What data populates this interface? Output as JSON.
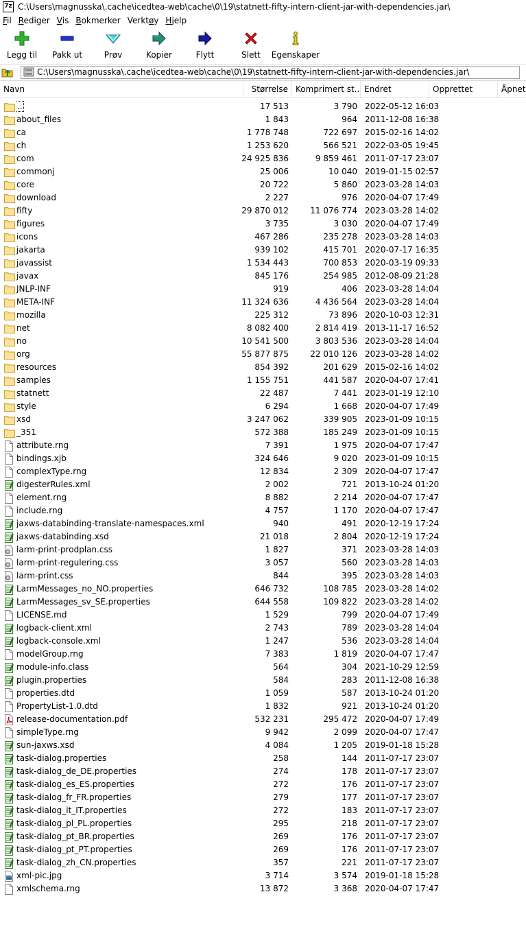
{
  "window": {
    "logo_text": "7z",
    "title": "C:\\Users\\magnusska\\.cache\\icedtea-web\\cache\\0\\19\\statnett-fifty-intern-client-jar-with-dependencies.jar\\"
  },
  "menu": [
    {
      "pre": "",
      "u": "F",
      "post": "il"
    },
    {
      "pre": "",
      "u": "R",
      "post": "ediger"
    },
    {
      "pre": "",
      "u": "V",
      "post": "is"
    },
    {
      "pre": "",
      "u": "B",
      "post": "okmerker"
    },
    {
      "pre": "Verkt",
      "u": "ø",
      "post": "y"
    },
    {
      "pre": "",
      "u": "H",
      "post": "jelp"
    }
  ],
  "toolbar": {
    "add": "Legg til",
    "extract": "Pakk ut",
    "test": "Prøv",
    "copy": "Kopier",
    "move": "Flytt",
    "delete": "Slett",
    "info": "Egenskaper"
  },
  "address": {
    "path": "C:\\Users\\magnusska\\.cache\\icedtea-web\\cache\\0\\19\\statnett-fifty-intern-client-jar-with-dependencies.jar\\"
  },
  "columns": {
    "name": "Navn",
    "size": "Størrelse",
    "packed": "Komprimert st...",
    "modified": "Endret",
    "created": "Opprettet",
    "accessed": "Åpnet"
  },
  "rows": [
    {
      "name": "..",
      "size": "17 513",
      "packed": "3 790",
      "modified": "2022-05-12 16:03",
      "type": "folder"
    },
    {
      "name": "about_files",
      "size": "1 843",
      "packed": "964",
      "modified": "2011-12-08 16:38",
      "type": "folder"
    },
    {
      "name": "ca",
      "size": "1 778 748",
      "packed": "722 697",
      "modified": "2015-02-16 14:02",
      "type": "folder"
    },
    {
      "name": "ch",
      "size": "1 253 620",
      "packed": "566 521",
      "modified": "2022-03-05 19:45",
      "type": "folder"
    },
    {
      "name": "com",
      "size": "24 925 836",
      "packed": "9 859 461",
      "modified": "2011-07-17 23:07",
      "type": "folder"
    },
    {
      "name": "commonj",
      "size": "25 006",
      "packed": "10 040",
      "modified": "2019-01-15 02:57",
      "type": "folder"
    },
    {
      "name": "core",
      "size": "20 722",
      "packed": "5 860",
      "modified": "2023-03-28 14:03",
      "type": "folder"
    },
    {
      "name": "download",
      "size": "2 227",
      "packed": "976",
      "modified": "2020-04-07 17:49",
      "type": "folder"
    },
    {
      "name": "fifty",
      "size": "29 870 012",
      "packed": "11 076 774",
      "modified": "2023-03-28 14:02",
      "type": "folder"
    },
    {
      "name": "figures",
      "size": "3 735",
      "packed": "3 030",
      "modified": "2020-04-07 17:49",
      "type": "folder"
    },
    {
      "name": "icons",
      "size": "467 286",
      "packed": "235 278",
      "modified": "2023-03-28 14:03",
      "type": "folder"
    },
    {
      "name": "jakarta",
      "size": "939 102",
      "packed": "415 701",
      "modified": "2020-07-17 16:35",
      "type": "folder"
    },
    {
      "name": "javassist",
      "size": "1 534 443",
      "packed": "700 853",
      "modified": "2020-03-19 09:33",
      "type": "folder"
    },
    {
      "name": "javax",
      "size": "845 176",
      "packed": "254 985",
      "modified": "2012-08-09 21:28",
      "type": "folder"
    },
    {
      "name": "JNLP-INF",
      "size": "919",
      "packed": "406",
      "modified": "2023-03-28 14:04",
      "type": "folder"
    },
    {
      "name": "META-INF",
      "size": "11 324 636",
      "packed": "4 436 564",
      "modified": "2023-03-28 14:04",
      "type": "folder"
    },
    {
      "name": "mozilla",
      "size": "225 312",
      "packed": "73 896",
      "modified": "2020-10-03 12:31",
      "type": "folder"
    },
    {
      "name": "net",
      "size": "8 082 400",
      "packed": "2 814 419",
      "modified": "2013-11-17 16:52",
      "type": "folder"
    },
    {
      "name": "no",
      "size": "10 541 500",
      "packed": "3 803 536",
      "modified": "2023-03-28 14:04",
      "type": "folder"
    },
    {
      "name": "org",
      "size": "55 877 875",
      "packed": "22 010 126",
      "modified": "2023-03-28 14:02",
      "type": "folder"
    },
    {
      "name": "resources",
      "size": "854 392",
      "packed": "201 629",
      "modified": "2015-02-16 14:02",
      "type": "folder"
    },
    {
      "name": "samples",
      "size": "1 155 751",
      "packed": "441 587",
      "modified": "2020-04-07 17:41",
      "type": "folder"
    },
    {
      "name": "statnett",
      "size": "22 487",
      "packed": "7 441",
      "modified": "2023-01-19 12:10",
      "type": "folder"
    },
    {
      "name": "style",
      "size": "6 294",
      "packed": "1 668",
      "modified": "2020-04-07 17:49",
      "type": "folder"
    },
    {
      "name": "xsd",
      "size": "3 247 062",
      "packed": "339 905",
      "modified": "2023-01-09 10:15",
      "type": "folder"
    },
    {
      "name": "_351",
      "size": "572 388",
      "packed": "185 249",
      "modified": "2023-01-09 10:15",
      "type": "folder"
    },
    {
      "name": "attribute.rng",
      "size": "7 391",
      "packed": "1 975",
      "modified": "2020-04-07 17:47",
      "type": "file"
    },
    {
      "name": "bindings.xjb",
      "size": "324 646",
      "packed": "9 020",
      "modified": "2023-01-09 10:15",
      "type": "file"
    },
    {
      "name": "complexType.rng",
      "size": "12 834",
      "packed": "2 309",
      "modified": "2020-04-07 17:47",
      "type": "file"
    },
    {
      "name": "digesterRules.xml",
      "size": "2 002",
      "packed": "721",
      "modified": "2013-10-24 01:20",
      "type": "notepad"
    },
    {
      "name": "element.rng",
      "size": "8 882",
      "packed": "2 214",
      "modified": "2020-04-07 17:47",
      "type": "file"
    },
    {
      "name": "include.rng",
      "size": "4 757",
      "packed": "1 170",
      "modified": "2020-04-07 17:47",
      "type": "file"
    },
    {
      "name": "jaxws-databinding-translate-namespaces.xml",
      "size": "940",
      "packed": "491",
      "modified": "2020-12-19 17:24",
      "type": "notepad"
    },
    {
      "name": "jaxws-databinding.xsd",
      "size": "21 018",
      "packed": "2 804",
      "modified": "2020-12-19 17:24",
      "type": "notepad"
    },
    {
      "name": "larm-print-prodplan.css",
      "size": "1 827",
      "packed": "371",
      "modified": "2023-03-28 14:03",
      "type": "css"
    },
    {
      "name": "larm-print-regulering.css",
      "size": "3 057",
      "packed": "560",
      "modified": "2023-03-28 14:03",
      "type": "css"
    },
    {
      "name": "larm-print.css",
      "size": "844",
      "packed": "395",
      "modified": "2023-03-28 14:03",
      "type": "css"
    },
    {
      "name": "LarmMessages_no_NO.properties",
      "size": "646 732",
      "packed": "108 785",
      "modified": "2023-03-28 14:02",
      "type": "notepad"
    },
    {
      "name": "LarmMessages_sv_SE.properties",
      "size": "644 558",
      "packed": "109 822",
      "modified": "2023-03-28 14:02",
      "type": "notepad"
    },
    {
      "name": "LICENSE.md",
      "size": "1 529",
      "packed": "799",
      "modified": "2020-04-07 17:49",
      "type": "file"
    },
    {
      "name": "logback-client.xml",
      "size": "2 743",
      "packed": "789",
      "modified": "2023-03-28 14:04",
      "type": "notepad"
    },
    {
      "name": "logback-console.xml",
      "size": "1 247",
      "packed": "536",
      "modified": "2023-03-28 14:04",
      "type": "notepad"
    },
    {
      "name": "modelGroup.rng",
      "size": "7 383",
      "packed": "1 819",
      "modified": "2020-04-07 17:47",
      "type": "file"
    },
    {
      "name": "module-info.class",
      "size": "564",
      "packed": "304",
      "modified": "2021-10-29 12:59",
      "type": "notepad"
    },
    {
      "name": "plugin.properties",
      "size": "584",
      "packed": "283",
      "modified": "2011-12-08 16:38",
      "type": "notepad"
    },
    {
      "name": "properties.dtd",
      "size": "1 059",
      "packed": "587",
      "modified": "2013-10-24 01:20",
      "type": "file"
    },
    {
      "name": "PropertyList-1.0.dtd",
      "size": "1 832",
      "packed": "921",
      "modified": "2013-10-24 01:20",
      "type": "file"
    },
    {
      "name": "release-documentation.pdf",
      "size": "532 231",
      "packed": "295 472",
      "modified": "2020-04-07 17:49",
      "type": "pdf"
    },
    {
      "name": "simpleType.rng",
      "size": "9 942",
      "packed": "2 099",
      "modified": "2020-04-07 17:47",
      "type": "file"
    },
    {
      "name": "sun-jaxws.xsd",
      "size": "4 084",
      "packed": "1 205",
      "modified": "2019-01-18 15:28",
      "type": "notepad"
    },
    {
      "name": "task-dialog.properties",
      "size": "258",
      "packed": "144",
      "modified": "2011-07-17 23:07",
      "type": "notepad"
    },
    {
      "name": "task-dialog_de_DE.properties",
      "size": "274",
      "packed": "178",
      "modified": "2011-07-17 23:07",
      "type": "notepad"
    },
    {
      "name": "task-dialog_es_ES.properties",
      "size": "272",
      "packed": "176",
      "modified": "2011-07-17 23:07",
      "type": "notepad"
    },
    {
      "name": "task-dialog_fr_FR.properties",
      "size": "279",
      "packed": "177",
      "modified": "2011-07-17 23:07",
      "type": "notepad"
    },
    {
      "name": "task-dialog_it_IT.properties",
      "size": "272",
      "packed": "183",
      "modified": "2011-07-17 23:07",
      "type": "notepad"
    },
    {
      "name": "task-dialog_pl_PL.properties",
      "size": "295",
      "packed": "218",
      "modified": "2011-07-17 23:07",
      "type": "notepad"
    },
    {
      "name": "task-dialog_pt_BR.properties",
      "size": "269",
      "packed": "176",
      "modified": "2011-07-17 23:07",
      "type": "notepad"
    },
    {
      "name": "task-dialog_pt_PT.properties",
      "size": "269",
      "packed": "176",
      "modified": "2011-07-17 23:07",
      "type": "notepad"
    },
    {
      "name": "task-dialog_zh_CN.properties",
      "size": "357",
      "packed": "221",
      "modified": "2011-07-17 23:07",
      "type": "notepad"
    },
    {
      "name": "xml-pic.jpg",
      "size": "3 714",
      "packed": "3 574",
      "modified": "2019-01-18 15:28",
      "type": "image"
    },
    {
      "name": "xmlschema.rng",
      "size": "13 872",
      "packed": "3 368",
      "modified": "2020-04-07 17:47",
      "type": "file"
    }
  ]
}
